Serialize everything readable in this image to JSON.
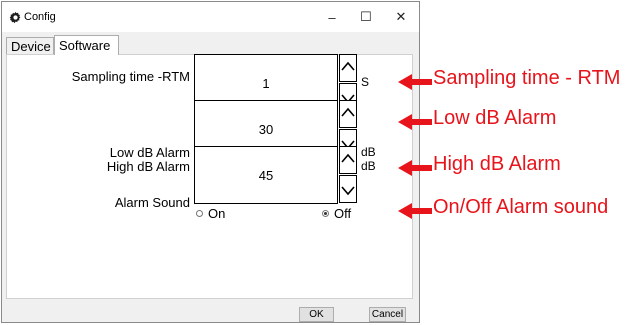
{
  "window": {
    "title": "Config",
    "controls": {
      "minimize": "–",
      "maximize": "☐",
      "close": "✕"
    }
  },
  "tabs": [
    {
      "label": "Device",
      "active": false
    },
    {
      "label": "Software",
      "active": true
    }
  ],
  "fields": {
    "sampling": {
      "label": "Sampling time -RTM",
      "value": "1",
      "unit": "S"
    },
    "low_db": {
      "label": "Low dB Alarm",
      "value": "30",
      "unit": "dB"
    },
    "high_db": {
      "label": "High dB Alarm",
      "value": "45",
      "unit": "dB"
    },
    "alarm_sound": {
      "label": "Alarm Sound",
      "options": [
        {
          "label": "On",
          "checked": false
        },
        {
          "label": "Off",
          "checked": true
        }
      ]
    }
  },
  "buttons": {
    "ok": "OK",
    "cancel": "Cancel"
  },
  "annotations": [
    "Sampling time - RTM",
    "Low dB Alarm",
    "High dB Alarm",
    "On/Off Alarm sound"
  ],
  "colors": {
    "annotation": "#e8141b"
  },
  "icons": {
    "app": "gear-icon",
    "spin_up": "chevron-up-icon",
    "spin_down": "chevron-down-icon",
    "annotation": "arrow-left-icon"
  }
}
